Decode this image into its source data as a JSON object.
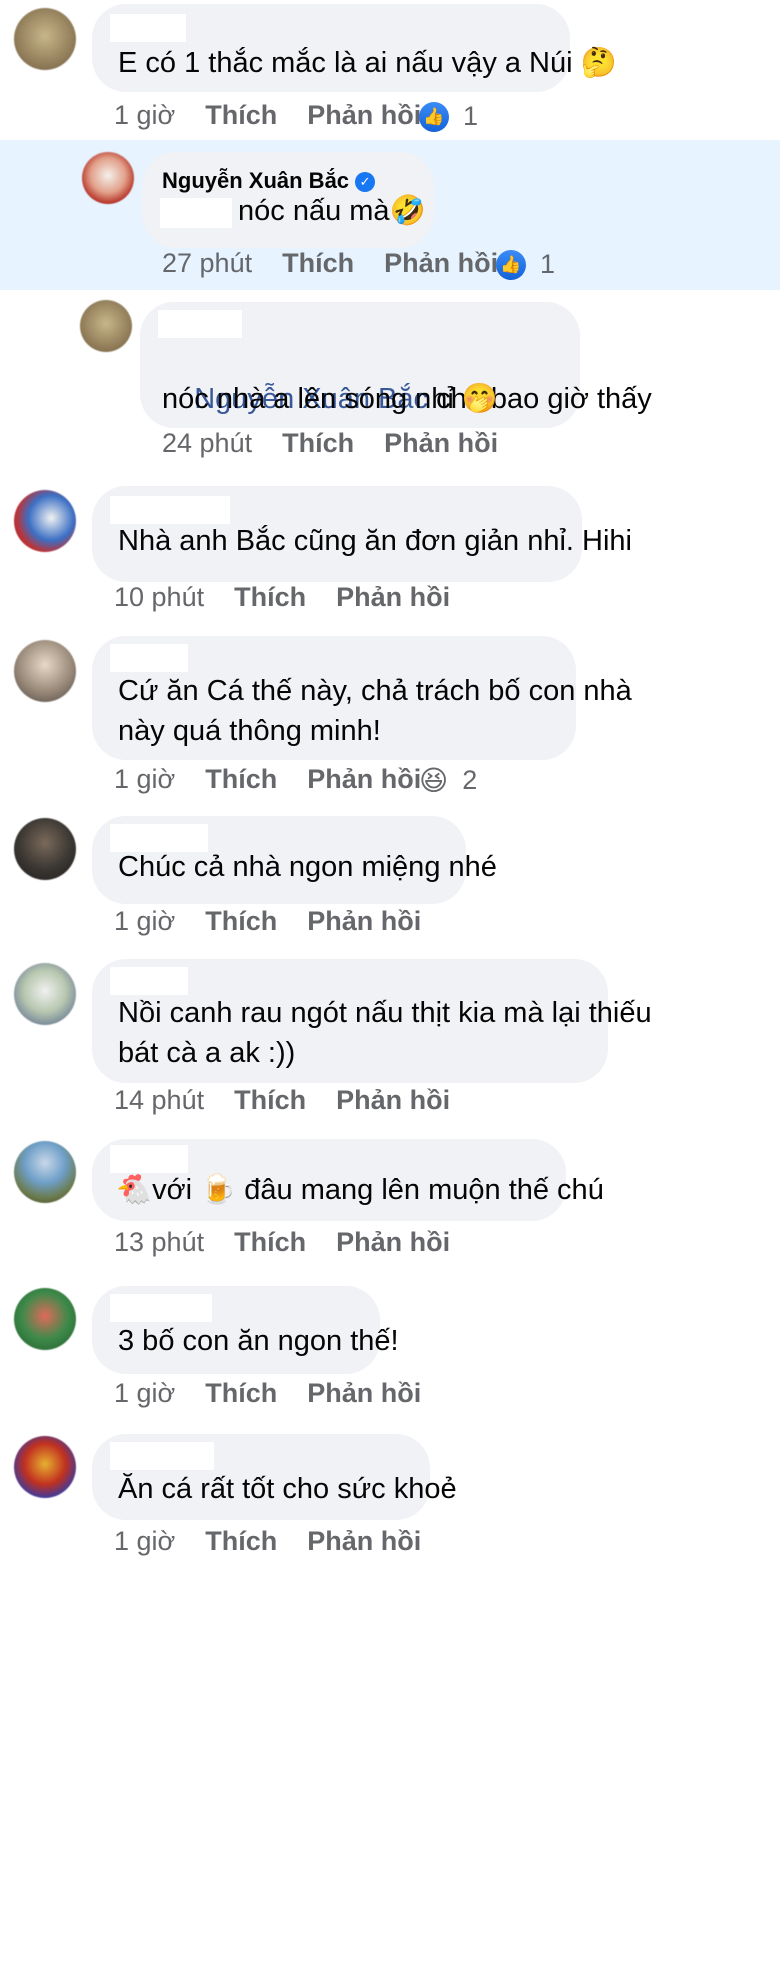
{
  "colors": {
    "bubble": "#f0f2f5",
    "highlight": "#e7f3ff",
    "meta": "#65676b",
    "mention": "#385898",
    "like": "#1877f2"
  },
  "comments": [
    {
      "name": "",
      "text": "E có 1 thắc mắc là ai nấu vậy a Núi 🤔",
      "time": "1 giờ",
      "like": "Thích",
      "reply": "Phản hồi",
      "reaction_icon": "like-icon",
      "reaction_count": "1"
    },
    {
      "name": "Nguyễn Xuân Bắc",
      "verified": true,
      "text_after_redact": "nóc nấu mà🤣",
      "time": "27 phút",
      "like": "Thích",
      "reply": "Phản hồi",
      "reaction_icon": "like-icon",
      "reaction_count": "1"
    },
    {
      "name": "",
      "mention": "Nguyễn Xuân Bắc",
      "text_line1": " chả bao giờ thấy",
      "text_line2": "nóc nhà a lên sóng nhỉ 🤭",
      "time": "24 phút",
      "like": "Thích",
      "reply": "Phản hồi"
    },
    {
      "name": "",
      "text": "Nhà anh Bắc cũng ăn đơn giản nhỉ. Hihi",
      "time": "10 phút",
      "like": "Thích",
      "reply": "Phản hồi"
    },
    {
      "name": "",
      "text_line1": "Cứ ăn Cá thế này, chả trách bố con nhà",
      "text_line2": "này quá thông minh!",
      "time": "1 giờ",
      "like": "Thích",
      "reply": "Phản hồi",
      "reaction_icon": "haha-icon",
      "reaction_count": "2"
    },
    {
      "name": "",
      "text": "Chúc cả nhà ngon miệng nhé",
      "time": "1 giờ",
      "like": "Thích",
      "reply": "Phản hồi"
    },
    {
      "name": "",
      "text_line1": "Nồi canh rau ngót nấu thịt kia mà lại thiếu",
      "text_line2": "bát cà a ak :))",
      "time": "14 phút",
      "like": "Thích",
      "reply": "Phản hồi"
    },
    {
      "name": "",
      "text": "🐔với 🍺 đâu mang lên muộn thế chú",
      "time": "13 phút",
      "like": "Thích",
      "reply": "Phản hồi"
    },
    {
      "name": "",
      "text": "3 bố con ăn ngon thế!",
      "time": "1 giờ",
      "like": "Thích",
      "reply": "Phản hồi"
    },
    {
      "name": "",
      "text": "Ăn cá rất tốt cho sức khoẻ",
      "time": "1 giờ",
      "like": "Thích",
      "reply": "Phản hồi"
    }
  ]
}
